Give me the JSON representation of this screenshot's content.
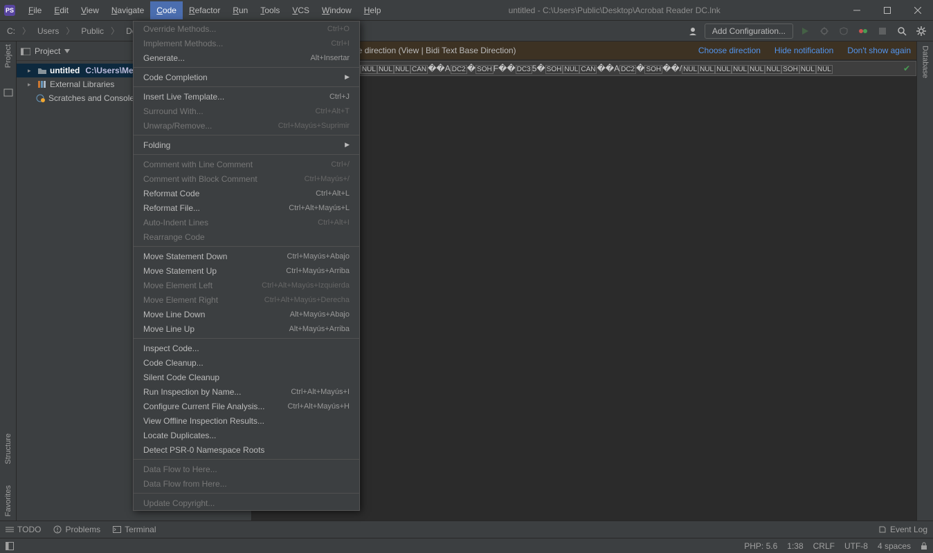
{
  "title": "untitled - C:\\Users\\Public\\Desktop\\Acrobat Reader DC.lnk",
  "menubar": [
    "File",
    "Edit",
    "View",
    "Navigate",
    "Code",
    "Refactor",
    "Run",
    "Tools",
    "VCS",
    "Window",
    "Help"
  ],
  "menubar_active": 4,
  "breadcrumb": [
    "C:",
    "Users",
    "Public",
    "Desktop"
  ],
  "addconfig_label": "Add Configuration...",
  "left_gutter": {
    "project": "Project"
  },
  "right_gutter": {
    "database": "Database"
  },
  "left_gutter_bottom": {
    "structure": "Structure",
    "favorites": "Favorites"
  },
  "sidebar": {
    "header_label": "Project",
    "tree": {
      "project_name": "untitled",
      "project_path": "C:\\Users\\Merch",
      "ext_libs": "External Libraries",
      "scratches": "Scratches and Consoles"
    }
  },
  "infobar": {
    "text": "text can depend on the base direction (View | Bidi Text Base Direction)",
    "links": [
      "Choose direction",
      "Hide notification",
      "Don't show again"
    ]
  },
  "code_tokens": "NUL NUL F �@ NUL NUL   NUL NUL NUL NUL CAN ��A DC2 � SOH F�� DC3 5� SOH NUL CAN ��A DC2 � SOH ��/ NUL NUL NUL NUL NUL NUL SOH NUL NUL",
  "bottombar": {
    "todo": "TODO",
    "problems": "Problems",
    "terminal": "Terminal",
    "eventlog": "Event Log"
  },
  "statusbar": {
    "php": "PHP: 5.6",
    "pos": "1:38",
    "le": "CRLF",
    "enc": "UTF-8",
    "indent": "4 spaces"
  },
  "menu": [
    {
      "type": "item",
      "label": "Override Methods...",
      "sc": "Ctrl+O",
      "disabled": true
    },
    {
      "type": "item",
      "label": "Implement Methods...",
      "sc": "Ctrl+I",
      "disabled": true
    },
    {
      "type": "item",
      "label": "Generate...",
      "sc": "Alt+Insertar"
    },
    {
      "type": "sep"
    },
    {
      "type": "submenu",
      "label": "Code Completion"
    },
    {
      "type": "sep"
    },
    {
      "type": "item",
      "label": "Insert Live Template...",
      "sc": "Ctrl+J"
    },
    {
      "type": "item",
      "label": "Surround With...",
      "sc": "Ctrl+Alt+T",
      "disabled": true
    },
    {
      "type": "item",
      "label": "Unwrap/Remove...",
      "sc": "Ctrl+Mayús+Suprimir",
      "disabled": true
    },
    {
      "type": "sep"
    },
    {
      "type": "submenu",
      "label": "Folding"
    },
    {
      "type": "sep"
    },
    {
      "type": "item",
      "label": "Comment with Line Comment",
      "sc": "Ctrl+/",
      "disabled": true
    },
    {
      "type": "item",
      "label": "Comment with Block Comment",
      "sc": "Ctrl+Mayús+/",
      "disabled": true
    },
    {
      "type": "item",
      "label": "Reformat Code",
      "sc": "Ctrl+Alt+L"
    },
    {
      "type": "item",
      "label": "Reformat File...",
      "sc": "Ctrl+Alt+Mayús+L"
    },
    {
      "type": "item",
      "label": "Auto-Indent Lines",
      "sc": "Ctrl+Alt+I",
      "disabled": true
    },
    {
      "type": "item",
      "label": "Rearrange Code",
      "disabled": true
    },
    {
      "type": "sep"
    },
    {
      "type": "item",
      "label": "Move Statement Down",
      "sc": "Ctrl+Mayús+Abajo"
    },
    {
      "type": "item",
      "label": "Move Statement Up",
      "sc": "Ctrl+Mayús+Arriba"
    },
    {
      "type": "item",
      "label": "Move Element Left",
      "sc": "Ctrl+Alt+Mayús+Izquierda",
      "disabled": true
    },
    {
      "type": "item",
      "label": "Move Element Right",
      "sc": "Ctrl+Alt+Mayús+Derecha",
      "disabled": true
    },
    {
      "type": "item",
      "label": "Move Line Down",
      "sc": "Alt+Mayús+Abajo"
    },
    {
      "type": "item",
      "label": "Move Line Up",
      "sc": "Alt+Mayús+Arriba"
    },
    {
      "type": "sep"
    },
    {
      "type": "item",
      "label": "Inspect Code..."
    },
    {
      "type": "item",
      "label": "Code Cleanup..."
    },
    {
      "type": "item",
      "label": "Silent Code Cleanup"
    },
    {
      "type": "item",
      "label": "Run Inspection by Name...",
      "sc": "Ctrl+Alt+Mayús+I"
    },
    {
      "type": "item",
      "label": "Configure Current File Analysis...",
      "sc": "Ctrl+Alt+Mayús+H"
    },
    {
      "type": "item",
      "label": "View Offline Inspection Results..."
    },
    {
      "type": "item",
      "label": "Locate Duplicates..."
    },
    {
      "type": "item",
      "label": "Detect PSR-0 Namespace Roots"
    },
    {
      "type": "sep"
    },
    {
      "type": "item",
      "label": "Data Flow to Here...",
      "disabled": true
    },
    {
      "type": "item",
      "label": "Data Flow from Here...",
      "disabled": true
    },
    {
      "type": "sep"
    },
    {
      "type": "item",
      "label": "Update Copyright...",
      "disabled": true
    }
  ]
}
